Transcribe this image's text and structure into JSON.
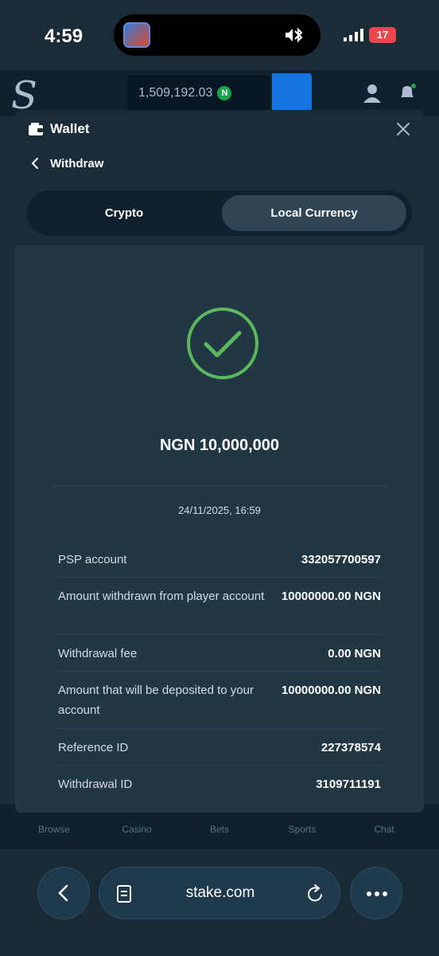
{
  "status_bar": {
    "time": "4:59",
    "battery": "17"
  },
  "background_app": {
    "balance": "1,509,192.03",
    "currency_badge": "N",
    "nav": [
      "Browse",
      "Casino",
      "Bets",
      "Sports",
      "Chat"
    ]
  },
  "modal": {
    "title": "Wallet",
    "subtitle": "Withdraw",
    "tabs": [
      {
        "label": "Crypto",
        "active": false
      },
      {
        "label": "Local Currency",
        "active": true
      }
    ],
    "amount": "NGN 10,000,000",
    "datetime": "24/11/2025, 16:59",
    "details": [
      {
        "label": "PSP account",
        "value": "332057700597"
      },
      {
        "label": "Amount withdrawn from player account",
        "value": "10000000.00 NGN"
      },
      {
        "label": "Withdrawal fee",
        "value": "0.00 NGN"
      },
      {
        "label": "Amount that will be deposited to your account",
        "value": "10000000.00 NGN"
      },
      {
        "label": "Reference ID",
        "value": "227378574"
      },
      {
        "label": "Withdrawal ID",
        "value": "3109711191"
      }
    ]
  },
  "browser": {
    "url": "stake.com"
  },
  "colors": {
    "success": "#5cb85c",
    "accent": "#1475e1",
    "panel": "#213743"
  },
  "icons": [
    "wallet-icon",
    "close-icon",
    "chevron-left-icon",
    "check-circle-icon",
    "tabs-icon",
    "reload-icon",
    "more-icon",
    "bluetooth-icon",
    "mute-icon"
  ]
}
